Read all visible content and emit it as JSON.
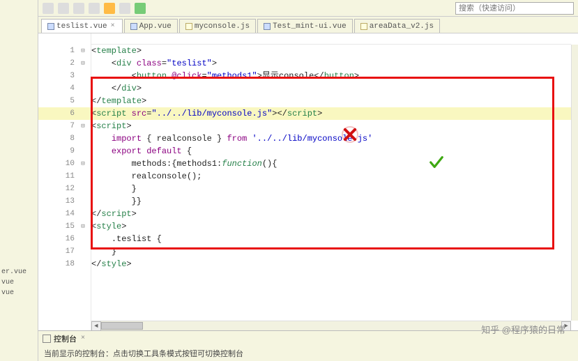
{
  "toolbar": {
    "search_placeholder": "搜索（快速访问）"
  },
  "tabs": {
    "items": [
      {
        "label": "teslist.vue",
        "active": true
      },
      {
        "label": "App.vue",
        "active": false
      },
      {
        "label": "myconsole.js",
        "active": false
      },
      {
        "label": "Test_mint-ui.vue",
        "active": false
      },
      {
        "label": "areaData_v2.js",
        "active": false
      }
    ]
  },
  "code": {
    "l1": "template",
    "l2_cls": "teslist",
    "l3_btn": "button",
    "l3_at": "@click",
    "l3_val": "methods1",
    "l3_txt": "显示console",
    "l6_src": "../../lib/myconsole.js",
    "l8_kw1": "import",
    "l8_id": "realconsole",
    "l8_kw2": "from",
    "l8_str": "'../../lib/myconsole.js'",
    "l9_kw": "export default",
    "l10_m": "methods",
    "l10_fn": "function",
    "l11": "realconsole();",
    "l16_cls": ".teslist {"
  },
  "sidebar": {
    "items": [
      "er.vue",
      "vue",
      "vue"
    ]
  },
  "console": {
    "tab_label": "控制台",
    "msg": "当前显示的控制台：点击切换工具条模式按钮可切换控制台"
  },
  "watermark": "知乎 @程序猿的日常"
}
